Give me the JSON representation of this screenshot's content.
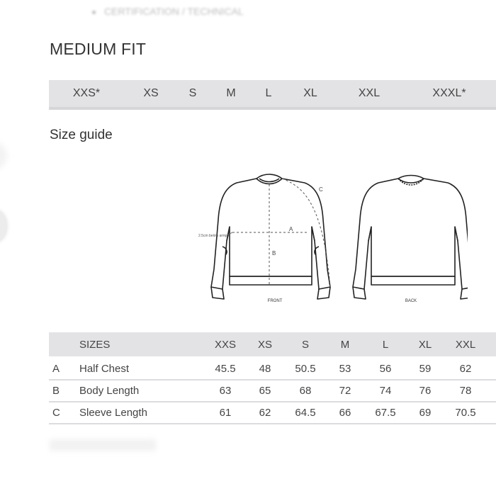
{
  "top_bullet": "CERTIFICATION / TECHNICAL",
  "page_title": "MEDIUM FIT",
  "size_band": [
    "XXS*",
    "XS",
    "S",
    "M",
    "L",
    "XL",
    "XXL",
    "XXXL*"
  ],
  "guide_title": "Size guide",
  "diagram": {
    "front_label": "FRONT",
    "back_label": "BACK",
    "armpit_note": "2.5cm below armpit",
    "measure_letters": {
      "a": "A",
      "b": "B",
      "c": "C"
    }
  },
  "table": {
    "header_label": "SIZES",
    "sizes": [
      "XXS",
      "XS",
      "S",
      "M",
      "L",
      "XL",
      "XXL"
    ],
    "rows": [
      {
        "key": "A",
        "label": "Half Chest",
        "values": [
          "45.5",
          "48",
          "50.5",
          "53",
          "56",
          "59",
          "62"
        ]
      },
      {
        "key": "B",
        "label": "Body Length",
        "values": [
          "63",
          "65",
          "68",
          "72",
          "74",
          "76",
          "78"
        ]
      },
      {
        "key": "C",
        "label": "Sleeve Length",
        "values": [
          "61",
          "62",
          "64.5",
          "66",
          "67.5",
          "69",
          "70.5"
        ]
      }
    ]
  }
}
